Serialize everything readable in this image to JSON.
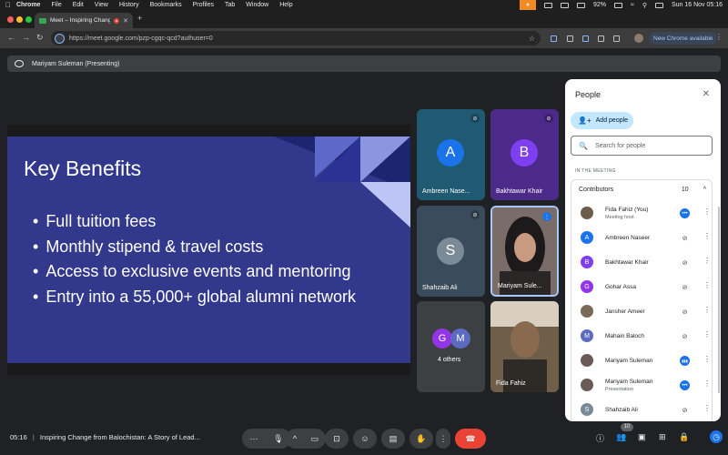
{
  "menubar": {
    "apple": "",
    "items": [
      "Chrome",
      "File",
      "Edit",
      "View",
      "History",
      "Bookmarks",
      "Profiles",
      "Tab",
      "Window",
      "Help"
    ],
    "battery": "92%",
    "datetime": "Sun 16 Nov  05:16"
  },
  "browser": {
    "tab_title": "Meet – Inspiring Change",
    "tab_close": "✕",
    "new_tab": "+",
    "url": "https://meet.google.com/pzp-cgqc-qcd?authuser=0",
    "new_chrome_label": "New Chrome available",
    "nav": {
      "back": "←",
      "forward": "→",
      "reload": "↻",
      "star": "☆",
      "menu": "⋮"
    }
  },
  "presenting_bar": {
    "label": "Mariyam Suleman (Presenting)"
  },
  "slide": {
    "title": "Key Benefits",
    "bullets": [
      "Full tuition fees",
      "Monthly stipend & travel costs",
      "Access to exclusive events and mentoring",
      "Entry into a 55,000+ global alumni network"
    ]
  },
  "tiles": [
    {
      "name": "Ambreen Nase...",
      "initial": "A",
      "bg": "#1f5a72",
      "avatar": "#1a73e8"
    },
    {
      "name": "Bakhtawar Khair",
      "initial": "B",
      "bg": "#4c2a8a",
      "avatar": "#7e3ff2"
    },
    {
      "name": "Shahzaib Ali",
      "initial": "S",
      "bg": "#3a4c5c",
      "avatar": "#7b8a97"
    },
    {
      "name": "Mariyam Sule...",
      "bg": "#6a5a58"
    },
    {
      "name": "4 others",
      "initials": [
        "G",
        "M"
      ],
      "bg": "#3c4043"
    },
    {
      "name": "Fida Fahiz",
      "bg": "#5a4a3c"
    }
  ],
  "bottombar": {
    "time": "05:16",
    "separator": "|",
    "meeting_title": "Inspiring Change from Balochistan: A Story of Lead...",
    "people_count": "10",
    "icons": {
      "more": "···",
      "mic": "🎙",
      "chevron": "^",
      "camera": "▭",
      "present": "⊡",
      "emoji": "☺",
      "captions": "▤",
      "hand": "✋",
      "options": "⋮",
      "end": "☎",
      "info": "ⓘ",
      "people": "👥",
      "chat": "▣",
      "activities": "⊞",
      "lock": "🔒",
      "timer": "◷"
    }
  },
  "people_panel": {
    "title": "People",
    "close": "✕",
    "add_people": "Add people",
    "add_icon": "👤+",
    "search_placeholder": "Search for people",
    "search_icon": "🔍",
    "section_label": "IN THE MEETING",
    "contributors_label": "Contributors",
    "contributors_count": "10",
    "chevron": "^",
    "more_icon": "⋮",
    "mic_off_icon": "⊘",
    "speaking_icon": "▮▮▮",
    "host_icon": "•••",
    "participants": [
      {
        "name": "Fida Fahiz (You)",
        "sub": "Meeting host",
        "color": "#6d5b4b",
        "initial": "",
        "status": "host"
      },
      {
        "name": "Ambreen Naseer",
        "sub": "",
        "color": "#1a73e8",
        "initial": "A",
        "status": "muted"
      },
      {
        "name": "Bakhtawar Khair",
        "sub": "",
        "color": "#7e3ff2",
        "initial": "B",
        "status": "muted"
      },
      {
        "name": "Gohar Assa",
        "sub": "",
        "color": "#9334e6",
        "initial": "G",
        "status": "muted"
      },
      {
        "name": "Jansher Ameer",
        "sub": "",
        "color": "#7a6a5a",
        "initial": "",
        "status": "muted"
      },
      {
        "name": "Mahain Baloch",
        "sub": "",
        "color": "#5c6bc0",
        "initial": "M",
        "status": "muted"
      },
      {
        "name": "Mariyam Suleman",
        "sub": "",
        "color": "#6a5a58",
        "initial": "",
        "status": "speaking"
      },
      {
        "name": "Mariyam Suleman",
        "sub": "Presentation",
        "color": "#6a5a58",
        "initial": "",
        "status": "host"
      },
      {
        "name": "Shahzaib Ali",
        "sub": "",
        "color": "#7b8a97",
        "initial": "S",
        "status": "muted"
      }
    ]
  }
}
